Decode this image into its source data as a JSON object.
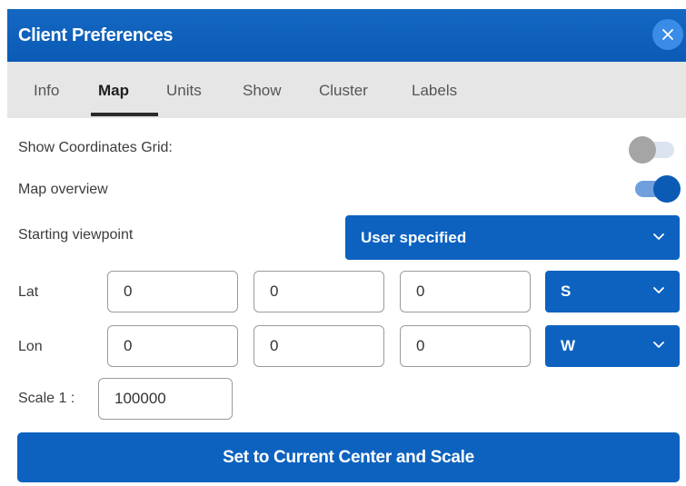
{
  "dialog": {
    "title": "Client Preferences"
  },
  "tabs": [
    {
      "label": "Info",
      "active": false
    },
    {
      "label": "Map",
      "active": true
    },
    {
      "label": "Units",
      "active": false
    },
    {
      "label": "Show",
      "active": false
    },
    {
      "label": "Cluster",
      "active": false
    },
    {
      "label": "Labels",
      "active": false
    }
  ],
  "map": {
    "coordinates_grid": {
      "label": "Show Coordinates Grid:",
      "enabled": false
    },
    "map_overview": {
      "label": "Map overview",
      "enabled": true
    },
    "starting_viewpoint": {
      "label": "Starting viewpoint",
      "selected": "User specified"
    },
    "lat": {
      "label": "Lat",
      "degrees": "0",
      "minutes": "0",
      "seconds": "0",
      "hemisphere": "S"
    },
    "lon": {
      "label": "Lon",
      "degrees": "0",
      "minutes": "0",
      "seconds": "0",
      "hemisphere": "W"
    },
    "scale": {
      "label": "Scale 1 :",
      "value": "100000"
    },
    "set_center_button": "Set to Current Center and Scale"
  },
  "colors": {
    "accent": "#0d62bf",
    "toggle_on": "#0b5bb5",
    "toggle_off": "#a5a5a5",
    "tabbar_bg": "#e6e6e6"
  },
  "icons": {
    "close": "close-icon",
    "dropdown": "chevron-down-icon"
  }
}
